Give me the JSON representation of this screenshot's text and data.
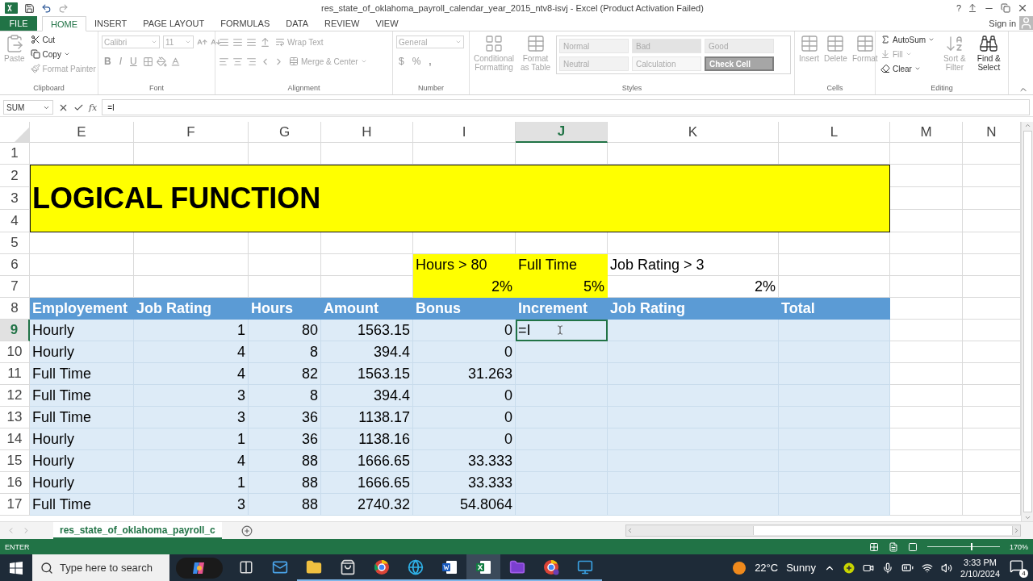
{
  "window": {
    "title": "res_state_of_oklahoma_payroll_calendar_year_2015_ntv8-isvj - Excel (Product Activation Failed)",
    "help": "?"
  },
  "ribbon_tabs": [
    {
      "label": "FILE",
      "kind": "file",
      "selected": false
    },
    {
      "label": "HOME",
      "kind": "tab",
      "selected": true
    },
    {
      "label": "INSERT",
      "kind": "tab",
      "selected": false
    },
    {
      "label": "PAGE LAYOUT",
      "kind": "tab",
      "selected": false
    },
    {
      "label": "FORMULAS",
      "kind": "tab",
      "selected": false
    },
    {
      "label": "DATA",
      "kind": "tab",
      "selected": false
    },
    {
      "label": "REVIEW",
      "kind": "tab",
      "selected": false
    },
    {
      "label": "VIEW",
      "kind": "tab",
      "selected": false
    }
  ],
  "account": {
    "label": "Sign in"
  },
  "ribbon_groups": [
    {
      "kind": "clipboard",
      "label": "Clipboard",
      "items": [
        {
          "label": "Paste",
          "disabled": true
        },
        {
          "label": "Cut",
          "disabled": false
        },
        {
          "label": "Copy",
          "disabled": false
        },
        {
          "label": "Format Painter",
          "disabled": true
        }
      ]
    },
    {
      "kind": "font",
      "label": "Font",
      "items": [
        {
          "label": "Calibri",
          "disabled": true
        },
        {
          "label": "11",
          "disabled": true
        },
        {
          "label": "B",
          "disabled": true
        },
        {
          "label": "I",
          "disabled": true
        },
        {
          "label": "U",
          "disabled": true
        }
      ]
    },
    {
      "kind": "alignment",
      "label": "Alignment",
      "items": [
        {
          "label": "Wrap Text",
          "disabled": true
        },
        {
          "label": "Merge & Center",
          "disabled": true
        }
      ]
    },
    {
      "kind": "number",
      "label": "Number",
      "items": [
        {
          "label": "General",
          "disabled": true
        },
        {
          "label": "$",
          "disabled": true
        },
        {
          "label": "%",
          "disabled": true
        },
        {
          "label": ",",
          "disabled": true
        }
      ]
    },
    {
      "kind": "styles",
      "label": "Styles",
      "items": [
        {
          "label": "Conditional Formatting",
          "disabled": true
        },
        {
          "label": "Format as Table",
          "disabled": true
        }
      ],
      "cell_styles": [
        {
          "label": "Normal",
          "color": "#f2f2f2"
        },
        {
          "label": "Bad",
          "color": "#e3e3e3"
        },
        {
          "label": "Good",
          "color": "#ededed"
        },
        {
          "label": "Neutral",
          "color": "#f2f2f2"
        },
        {
          "label": "Calculation",
          "color": "#f7f7f7"
        },
        {
          "label": "Check Cell",
          "color": "#a6a6a6"
        }
      ]
    },
    {
      "kind": "cells",
      "label": "Cells",
      "items": [
        {
          "label": "Insert",
          "disabled": true
        },
        {
          "label": "Delete",
          "disabled": true
        },
        {
          "label": "Format",
          "disabled": true
        }
      ]
    },
    {
      "kind": "editing",
      "label": "Editing",
      "items": [
        {
          "label": "AutoSum",
          "disabled": false
        },
        {
          "label": "Fill",
          "disabled": true
        },
        {
          "label": "Clear",
          "disabled": false
        },
        {
          "label": "Sort & Filter",
          "disabled": true
        },
        {
          "label": "Find & Select",
          "disabled": false
        }
      ]
    }
  ],
  "formula_bar": {
    "name_box": "SUM",
    "function_symbol": "fx",
    "formula": "=I"
  },
  "sheet": {
    "columns": [
      {
        "label": "E",
        "selected": false
      },
      {
        "label": "F",
        "selected": false
      },
      {
        "label": "G",
        "selected": false
      },
      {
        "label": "H",
        "selected": false
      },
      {
        "label": "I",
        "selected": false
      },
      {
        "label": "J",
        "selected": true
      },
      {
        "label": "K",
        "selected": false
      },
      {
        "label": "L",
        "selected": false
      },
      {
        "label": "M",
        "selected": false
      },
      {
        "label": "N",
        "selected": false
      }
    ],
    "rows": [
      {
        "number": "1",
        "kind": "blank",
        "selected": false
      },
      {
        "number": "2",
        "kind": "banner",
        "selected": false
      },
      {
        "number": "3",
        "kind": "banner",
        "selected": false,
        "text": "LOGICAL FUNCTION"
      },
      {
        "number": "4",
        "kind": "banner",
        "selected": false
      },
      {
        "number": "5",
        "kind": "blank",
        "selected": false
      },
      {
        "number": "6",
        "kind": "criteria",
        "selected": false,
        "cells": [
          null,
          null,
          null,
          null,
          {
            "text": "Hours > 80",
            "kind": "text",
            "highlighted": true
          },
          {
            "text": "Full Time",
            "kind": "text",
            "highlighted": true
          },
          {
            "text": "Job Rating > 3",
            "kind": "text",
            "highlighted": false
          },
          null
        ]
      },
      {
        "number": "7",
        "kind": "criteria",
        "selected": false,
        "cells": [
          null,
          null,
          null,
          null,
          {
            "text": "2%",
            "kind": "number",
            "highlighted": true
          },
          {
            "text": "5%",
            "kind": "number",
            "highlighted": true
          },
          {
            "text": "2%",
            "kind": "number",
            "highlighted": false
          },
          null
        ]
      },
      {
        "number": "8",
        "kind": "header",
        "selected": false,
        "cells": [
          {
            "text": "Employement",
            "kind": "text"
          },
          {
            "text": "Job Rating",
            "kind": "text"
          },
          {
            "text": "Hours",
            "kind": "text"
          },
          {
            "text": "Amount",
            "kind": "text"
          },
          {
            "text": "Bonus",
            "kind": "text"
          },
          {
            "text": "Increment",
            "kind": "text"
          },
          {
            "text": "Job Rating",
            "kind": "text"
          },
          {
            "text": "Total",
            "kind": "text"
          }
        ]
      },
      {
        "number": "9",
        "kind": "data",
        "selected": true,
        "cells": [
          {
            "text": "Hourly",
            "kind": "text"
          },
          {
            "text": "1",
            "kind": "number"
          },
          {
            "text": "80",
            "kind": "number"
          },
          {
            "text": "1563.15",
            "kind": "number"
          },
          {
            "text": "0",
            "kind": "number"
          },
          {
            "text": "=I",
            "kind": "text",
            "active": true
          },
          null,
          null
        ]
      },
      {
        "number": "10",
        "kind": "data",
        "selected": false,
        "cells": [
          {
            "text": "Hourly",
            "kind": "text"
          },
          {
            "text": "4",
            "kind": "number"
          },
          {
            "text": "8",
            "kind": "number"
          },
          {
            "text": "394.4",
            "kind": "number"
          },
          {
            "text": "0",
            "kind": "number"
          },
          null,
          null,
          null
        ]
      },
      {
        "number": "11",
        "kind": "data",
        "selected": false,
        "cells": [
          {
            "text": "Full Time",
            "kind": "text"
          },
          {
            "text": "4",
            "kind": "number"
          },
          {
            "text": "82",
            "kind": "number"
          },
          {
            "text": "1563.15",
            "kind": "number"
          },
          {
            "text": "31.263",
            "kind": "number"
          },
          null,
          null,
          null
        ]
      },
      {
        "number": "12",
        "kind": "data",
        "selected": false,
        "cells": [
          {
            "text": "Full Time",
            "kind": "text"
          },
          {
            "text": "3",
            "kind": "number"
          },
          {
            "text": "8",
            "kind": "number"
          },
          {
            "text": "394.4",
            "kind": "number"
          },
          {
            "text": "0",
            "kind": "number"
          },
          null,
          null,
          null
        ]
      },
      {
        "number": "13",
        "kind": "data",
        "selected": false,
        "cells": [
          {
            "text": "Full Time",
            "kind": "text"
          },
          {
            "text": "3",
            "kind": "number"
          },
          {
            "text": "36",
            "kind": "number"
          },
          {
            "text": "1138.17",
            "kind": "number"
          },
          {
            "text": "0",
            "kind": "number"
          },
          null,
          null,
          null
        ]
      },
      {
        "number": "14",
        "kind": "data",
        "selected": false,
        "cells": [
          {
            "text": "Hourly",
            "kind": "text"
          },
          {
            "text": "1",
            "kind": "number"
          },
          {
            "text": "36",
            "kind": "number"
          },
          {
            "text": "1138.16",
            "kind": "number"
          },
          {
            "text": "0",
            "kind": "number"
          },
          null,
          null,
          null
        ]
      },
      {
        "number": "15",
        "kind": "data",
        "selected": false,
        "cells": [
          {
            "text": "Hourly",
            "kind": "text"
          },
          {
            "text": "4",
            "kind": "number"
          },
          {
            "text": "88",
            "kind": "number"
          },
          {
            "text": "1666.65",
            "kind": "number"
          },
          {
            "text": "33.333",
            "kind": "number"
          },
          null,
          null,
          null
        ]
      },
      {
        "number": "16",
        "kind": "data",
        "selected": false,
        "cells": [
          {
            "text": "Hourly",
            "kind": "text"
          },
          {
            "text": "1",
            "kind": "number"
          },
          {
            "text": "88",
            "kind": "number"
          },
          {
            "text": "1666.65",
            "kind": "number"
          },
          {
            "text": "33.333",
            "kind": "number"
          },
          null,
          null,
          null
        ]
      },
      {
        "number": "17",
        "kind": "data",
        "selected": false,
        "cells": [
          {
            "text": "Full Time",
            "kind": "text"
          },
          {
            "text": "3",
            "kind": "number"
          },
          {
            "text": "88",
            "kind": "number"
          },
          {
            "text": "2740.32",
            "kind": "number"
          },
          {
            "text": "54.8064",
            "kind": "number"
          },
          null,
          null,
          null
        ]
      }
    ]
  },
  "sheet_tabs": [
    {
      "label": "res_state_of_oklahoma_payroll_c",
      "selected": true
    }
  ],
  "status_bar": {
    "mode": "ENTER",
    "zoom": {
      "label": "170%",
      "level": 0.6
    }
  },
  "taskbar": {
    "search_placeholder": "Type here to search",
    "apps": [
      {
        "selected": false,
        "running": false
      },
      {
        "selected": false,
        "running": false
      },
      {
        "selected": false,
        "running": true
      },
      {
        "selected": false,
        "running": true
      },
      {
        "selected": false,
        "running": true
      },
      {
        "selected": false,
        "running": true
      },
      {
        "selected": false,
        "running": true
      },
      {
        "selected": true,
        "running": true
      },
      {
        "selected": false,
        "running": true
      },
      {
        "selected": false,
        "running": true
      },
      {
        "selected": false,
        "running": true
      }
    ],
    "weather": {
      "temperature": "22°C",
      "condition": "Sunny"
    },
    "time": "3:33 PM",
    "date": "2/10/2024",
    "notifications": "4"
  }
}
